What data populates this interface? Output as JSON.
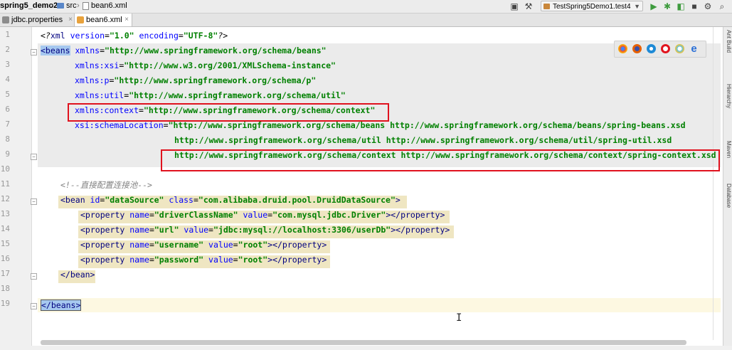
{
  "breadcrumb": {
    "project": "spring5_demo2",
    "folder": "src",
    "file": "bean6.xml"
  },
  "run_config": {
    "label": "TestSpring5Demo1.test4"
  },
  "tabs": [
    {
      "label": "jdbc.properties",
      "active": false
    },
    {
      "label": "bean6.xml",
      "active": true
    }
  ],
  "tab_close_glyph": "×",
  "line_numbers": [
    "1",
    "2",
    "3",
    "4",
    "5",
    "6",
    "7",
    "8",
    "9",
    "10",
    "11",
    "12",
    "13",
    "14",
    "15",
    "16",
    "17",
    "18",
    "19"
  ],
  "right_sidebar": [
    "Ant Build",
    "Hierarchy",
    "Maven",
    "Database"
  ],
  "code": {
    "l1": {
      "a": "<?",
      "b": "xml ",
      "c": "version",
      "d": "=",
      "e": "\"1.0\"",
      "f": " encoding",
      "g": "=",
      "h": "\"UTF-8\"",
      "i": "?>"
    },
    "l2": {
      "tag": "<beans",
      "attr": " xmlns",
      "eq": "=",
      "val": "\"http://www.springframework.org/schema/beans\""
    },
    "l3": {
      "attr": "xmlns:xsi",
      "eq": "=",
      "val": "\"http://www.w3.org/2001/XMLSchema-instance\""
    },
    "l4": {
      "attr": "xmlns:p",
      "eq": "=",
      "val": "\"http://www.springframework.org/schema/p\""
    },
    "l5": {
      "attr": "xmlns:util",
      "eq": "=",
      "val": "\"http://www.springframework.org/schema/util\""
    },
    "l6": {
      "attr": "xmlns:context",
      "eq": "=",
      "val": "\"http://www.springframework.org/schema/context\""
    },
    "l7": {
      "attr": "xsi:schemaLocation",
      "eq": "=",
      "val": "\"http://www.springframework.org/schema/beans http://www.springframework.org/schema/beans/spring-beans.xsd"
    },
    "l8": {
      "val": "http://www.springframework.org/schema/util http://www.springframework.org/schema/util/spring-util.xsd"
    },
    "l9": {
      "val": "http://www.springframework.org/schema/context http://www.springframework.org/schema/context/spring-context.xsd"
    },
    "l11": {
      "comment": "<!--直接配置连接池-->"
    },
    "l12": {
      "tag": "<bean",
      "a1": " id",
      "eq1": "=",
      "v1": "\"dataSource\"",
      "a2": " class",
      "eq2": "=",
      "v2": "\"com.alibaba.druid.pool.DruidDataSource\"",
      "close": ">"
    },
    "l13": {
      "tag": "<property",
      "a1": " name",
      "eq1": "=",
      "v1": "\"driverClassName\"",
      "a2": " value",
      "eq2": "=",
      "v2": "\"com.mysql.jdbc.Driver\"",
      "close": "></property>"
    },
    "l14": {
      "tag": "<property",
      "a1": " name",
      "eq1": "=",
      "v1": "\"url\"",
      "a2": " value",
      "eq2": "=",
      "v2": "\"jdbc:mysql://localhost:3306/userDb\"",
      "close": "></property>"
    },
    "l15": {
      "tag": "<property",
      "a1": " name",
      "eq1": "=",
      "v1": "\"username\"",
      "a2": " value",
      "eq2": "=",
      "v2": "\"root\"",
      "close": "></property>"
    },
    "l16": {
      "tag": "<property",
      "a1": " name",
      "eq1": "=",
      "v1": "\"password\"",
      "a2": " value",
      "eq2": "=",
      "v2": "\"root\"",
      "close": "></property>"
    },
    "l17": {
      "tag": "</bean>"
    },
    "l19": {
      "tag": "</beans>"
    }
  },
  "colors": {
    "tag": "#000080",
    "attribute": "#0000ff",
    "value": "#008000",
    "comment": "#808080",
    "annotation_box": "#e0121e"
  }
}
